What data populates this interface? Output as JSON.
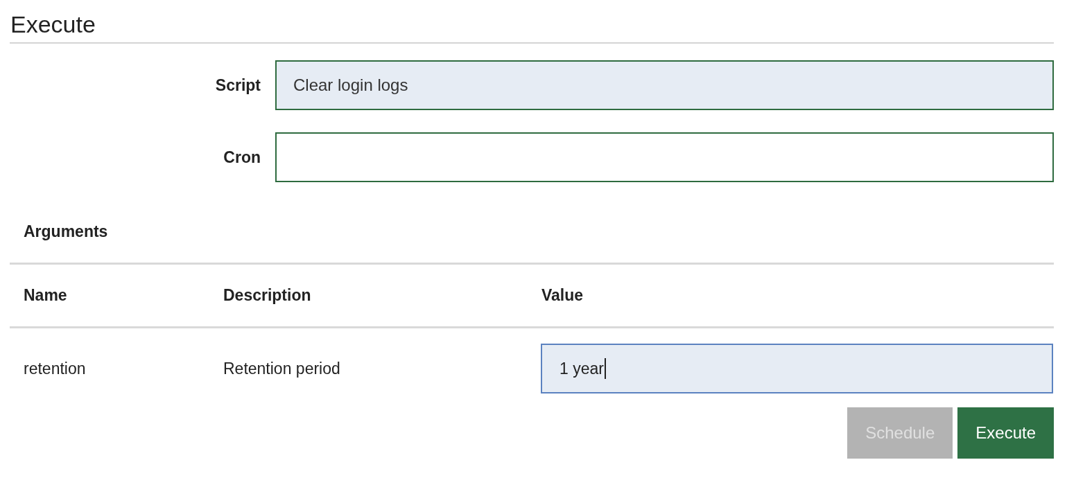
{
  "title": "Execute",
  "fields": [
    {
      "label": "Script",
      "value": "Clear login logs",
      "readonly": true
    },
    {
      "label": "Cron",
      "readonly": false
    }
  ],
  "arguments": {
    "heading": "Arguments",
    "columns": [
      "Name",
      "Description",
      "Value"
    ],
    "rows": [
      {
        "name": "retention",
        "description": "Retention period",
        "value": "1 year",
        "focused": true
      }
    ]
  },
  "buttons": [
    {
      "label": "Schedule",
      "kind": "secondary",
      "disabled": true
    },
    {
      "label": "Execute",
      "kind": "primary",
      "disabled": false
    }
  ]
}
